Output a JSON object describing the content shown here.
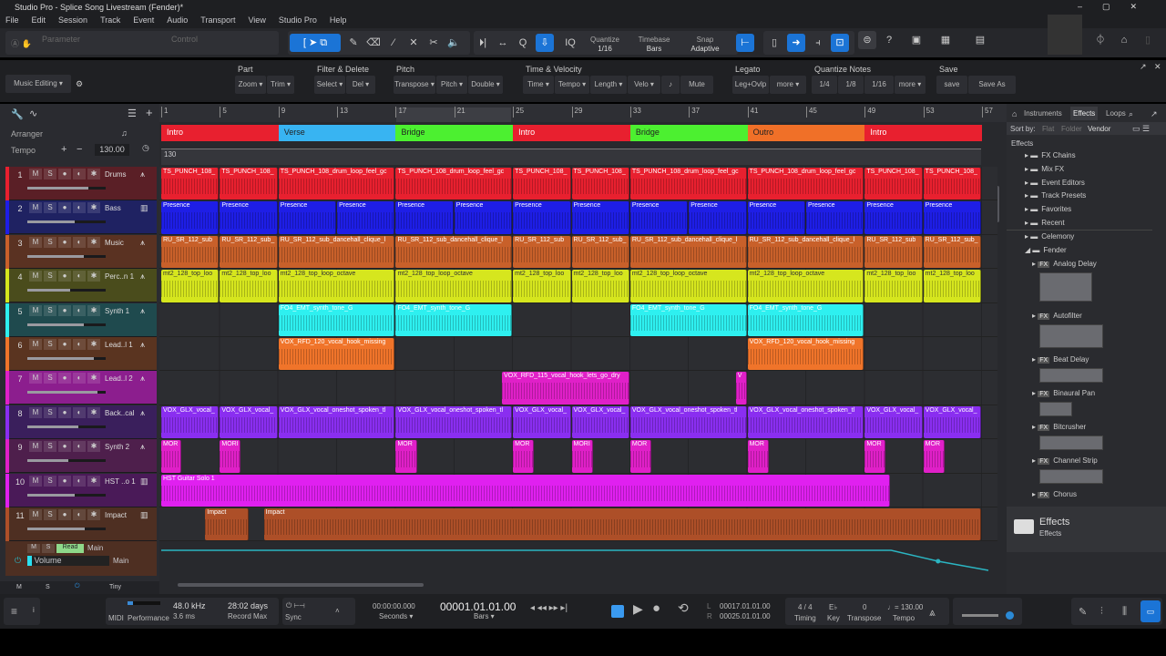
{
  "window_title": "Studio Pro - Splice Song Livestream (Fender)*",
  "menu": [
    "File",
    "Edit",
    "Session",
    "Track",
    "Event",
    "Audio",
    "Transport",
    "View",
    "Studio Pro",
    "Help"
  ],
  "toolbar": {
    "parameter": "Parameter",
    "control": "Control",
    "quantize_label": "Quantize",
    "quantize": "1/16",
    "timebase_label": "Timebase",
    "timebase": "Bars",
    "snap_label": "Snap",
    "snap": "Adaptive",
    "iq": "IQ",
    "help": "?"
  },
  "macro": {
    "preset": "Music Editing",
    "groups": [
      {
        "title": "Part",
        "buttons": [
          "Zoom ▾",
          "Trim ▾"
        ]
      },
      {
        "title": "Filter & Delete",
        "buttons": [
          "Select ▾",
          "Del ▾"
        ]
      },
      {
        "title": "Pitch",
        "buttons": [
          "Transpose ▾",
          "Pitch ▾",
          "Double ▾"
        ]
      },
      {
        "title": "Time & Velocity",
        "buttons": [
          "Time ▾",
          "Tempo ▾",
          "Length ▾",
          "Velo ▾",
          "♪",
          "Mute"
        ]
      },
      {
        "title": "Legato",
        "buttons": [
          "Leg+Ovlp",
          "more ▾"
        ]
      },
      {
        "title": "Quantize Notes",
        "buttons": [
          "1/4",
          "1/8",
          "1/16",
          "more ▾"
        ]
      },
      {
        "title": "Save",
        "buttons": [
          "save",
          "Save As"
        ]
      }
    ]
  },
  "arranger": {
    "label": "Arranger",
    "tempo_label": "Tempo",
    "tempo": "130.00",
    "tempo_lane_value": "130",
    "sections": [
      {
        "name": "Intro",
        "start": 1,
        "end": 9,
        "color": "#e8202f"
      },
      {
        "name": "Verse",
        "start": 9,
        "end": 17,
        "color": "#38b4f2"
      },
      {
        "name": "Bridge",
        "start": 17,
        "end": 25,
        "color": "#4cf030"
      },
      {
        "name": "Intro",
        "start": 25,
        "end": 33,
        "color": "#e8202f"
      },
      {
        "name": "Bridge",
        "start": 33,
        "end": 41,
        "color": "#4cf030"
      },
      {
        "name": "Outro",
        "start": 41,
        "end": 49,
        "color": "#f07028"
      },
      {
        "name": "Intro",
        "start": 49,
        "end": 57,
        "color": "#e8202f"
      }
    ],
    "ruler": [
      "1",
      "5",
      "9",
      "13",
      "17",
      "21",
      "25",
      "29",
      "33",
      "37",
      "41",
      "45",
      "49",
      "53",
      "57"
    ]
  },
  "tracks": [
    {
      "num": "1",
      "name": "Drums",
      "type": "audio",
      "color": "#e8202f",
      "bg": "#5a1f26",
      "fader": 0.78,
      "clips": [
        [
          1,
          5,
          "TS_PUNCH_108_"
        ],
        [
          5,
          9,
          "TS_PUNCH_108_"
        ],
        [
          9,
          17,
          "TS_PUNCH_108_drum_loop_feel_gc"
        ],
        [
          17,
          25,
          "TS_PUNCH_108_drum_loop_feel_gc"
        ],
        [
          25,
          29,
          "TS_PUNCH_108_"
        ],
        [
          29,
          33,
          "TS_PUNCH_108_"
        ],
        [
          33,
          41,
          "TS_PUNCH_108_drum_loop_feel_gc"
        ],
        [
          41,
          49,
          "TS_PUNCH_108_drum_loop_feel_gc"
        ],
        [
          49,
          53,
          "TS_PUNCH_108_"
        ],
        [
          53,
          57,
          "TS_PUNCH_108_"
        ]
      ]
    },
    {
      "num": "2",
      "name": "Bass",
      "type": "instrument",
      "color": "#1e1ee6",
      "bg": "#1f2262",
      "fader": 0.6,
      "clips": [
        [
          1,
          5,
          "Presence"
        ],
        [
          5,
          9,
          "Presence"
        ],
        [
          9,
          13,
          "Presence"
        ],
        [
          13,
          17,
          "Presence"
        ],
        [
          17,
          21,
          "Presence"
        ],
        [
          21,
          25,
          "Presence"
        ],
        [
          25,
          29,
          "Presence"
        ],
        [
          29,
          33,
          "Presence"
        ],
        [
          33,
          37,
          "Presence"
        ],
        [
          37,
          41,
          "Presence"
        ],
        [
          41,
          45,
          "Presence"
        ],
        [
          45,
          49,
          "Presence"
        ],
        [
          49,
          53,
          "Presence"
        ],
        [
          53,
          57,
          "Presence"
        ]
      ]
    },
    {
      "num": "3",
      "name": "Music",
      "type": "audio",
      "color": "#c8602a",
      "bg": "#5a3222",
      "fader": 0.72,
      "clips": [
        [
          1,
          5,
          "RU_SR_112_sub"
        ],
        [
          5,
          9,
          "RU_SR_112_sub_"
        ],
        [
          9,
          17,
          "RU_SR_112_sub_dancehall_clique_l"
        ],
        [
          17,
          25,
          "RU_SR_112_sub_dancehall_clique_l"
        ],
        [
          25,
          29,
          "RU_SR_112_sub"
        ],
        [
          29,
          33,
          "RU_SR_112_sub_"
        ],
        [
          33,
          41,
          "RU_SR_112_sub_dancehall_clique_l"
        ],
        [
          41,
          49,
          "RU_SR_112_sub_dancehall_clique_l"
        ],
        [
          49,
          53,
          "RU_SR_112_sub"
        ],
        [
          53,
          57,
          "RU_SR_112_sub_"
        ]
      ]
    },
    {
      "num": "4",
      "name": "Perc..n 1",
      "type": "audio",
      "color": "#d6e61e",
      "bg": "#4a4c1c",
      "fader": 0.55,
      "clips": [
        [
          1,
          5,
          "mt2_128_top_loo"
        ],
        [
          5,
          9,
          "mt2_128_top_loo"
        ],
        [
          9,
          17,
          "mt2_128_top_loop_octave"
        ],
        [
          17,
          25,
          "mt2_128_top_loop_octave"
        ],
        [
          25,
          29,
          "mt2_128_top_loo"
        ],
        [
          29,
          33,
          "mt2_128_top_loo"
        ],
        [
          33,
          41,
          "mt2_128_top_loop_octave"
        ],
        [
          41,
          49,
          "mt2_128_top_loop_octave"
        ],
        [
          49,
          53,
          "mt2_128_top_loo"
        ],
        [
          53,
          57,
          "mt2_128_top_loo"
        ]
      ]
    },
    {
      "num": "5",
      "name": "Synth 1",
      "type": "audio",
      "color": "#2ef0f0",
      "bg": "#1f4a4e",
      "fader": 0.72,
      "clips": [
        [
          9,
          17,
          "FO4_EMT_synth_tone_G"
        ],
        [
          17,
          25,
          "FO4_EMT_synth_tone_G"
        ],
        [
          33,
          41,
          "FO4_EMT_synth_tone_G"
        ],
        [
          41,
          49,
          "FO4_EMT_synth_tone_G"
        ]
      ]
    },
    {
      "num": "6",
      "name": "Lead..l 1",
      "type": "audio",
      "color": "#f0742a",
      "bg": "#5a3420",
      "fader": 0.85,
      "clips": [
        [
          9,
          17,
          "VOX_RFD_120_vocal_hook_missing"
        ],
        [
          41,
          49,
          "VOX_RFD_120_vocal_hook_missing"
        ]
      ]
    },
    {
      "num": "7",
      "name": "Lead..l 2",
      "type": "audio",
      "color": "#e020c8",
      "bg": "#8c1e8e",
      "fader": 0.9,
      "selected": true,
      "clips": [
        [
          24.25,
          33,
          "VOX_RFD_115_vocal_hook_lets_go_dry"
        ],
        [
          40.2,
          41,
          "V"
        ]
      ]
    },
    {
      "num": "8",
      "name": "Back..cal",
      "type": "audio",
      "color": "#8a2ef0",
      "bg": "#3a1f5c",
      "fader": 0.65,
      "clips": [
        [
          1,
          5,
          "VOX_GLX_vocal_"
        ],
        [
          5,
          9,
          "VOX_GLX_vocal_"
        ],
        [
          9,
          17,
          "VOX_GLX_vocal_oneshot_spoken_tl"
        ],
        [
          17,
          25,
          "VOX_GLX_vocal_oneshot_spoken_tl"
        ],
        [
          25,
          29,
          "VOX_GLX_vocal_"
        ],
        [
          29,
          33,
          "VOX_GLX_vocal_"
        ],
        [
          33,
          41,
          "VOX_GLX_vocal_oneshot_spoken_tl"
        ],
        [
          41,
          49,
          "VOX_GLX_vocal_oneshot_spoken_tl"
        ],
        [
          49,
          53,
          "VOX_GLX_vocal_"
        ],
        [
          53,
          57,
          "VOX_GLX_vocal_"
        ]
      ]
    },
    {
      "num": "9",
      "name": "Synth 2",
      "type": "audio",
      "color": "#e020c8",
      "bg": "#4e1f4c",
      "fader": 0.52,
      "clips": [
        [
          1,
          2.4,
          "MOR"
        ],
        [
          5,
          6.5,
          "MORI"
        ],
        [
          17,
          18.5,
          "MOR"
        ],
        [
          25,
          26.5,
          "MOR"
        ],
        [
          29,
          30.5,
          "MORI"
        ],
        [
          33,
          34.5,
          "MOR"
        ],
        [
          41,
          42.5,
          "MOR"
        ],
        [
          49,
          50.5,
          "MOR"
        ],
        [
          53,
          54.5,
          "MOR"
        ]
      ]
    },
    {
      "num": "10",
      "name": "HST ..o 1",
      "type": "instrument",
      "color": "#e020f0",
      "bg": "#4a1a58",
      "fader": 0.6,
      "clips": [
        [
          1,
          50.8,
          "HST Guitar Solo 1"
        ]
      ]
    },
    {
      "num": "11",
      "name": "Impact",
      "type": "instrument",
      "color": "#ad4f28",
      "bg": "#4e2f22",
      "fader": 0.73,
      "clips": [
        [
          4,
          7,
          "Impact"
        ],
        [
          8,
          57,
          "Impact"
        ]
      ]
    }
  ],
  "automation": {
    "m": "M",
    "s": "S",
    "mode": "Read",
    "target": "Main",
    "param": "Volume",
    "output": "Main"
  },
  "header_footer": {
    "m": "M",
    "s": "S",
    "size": "Tiny"
  },
  "browser": {
    "tabs": [
      "Instruments",
      "Effects",
      "Loops"
    ],
    "active_tab": "Effects",
    "sort_by": "Sort by:",
    "sort_options": [
      "Flat",
      "Folder",
      "Vendor"
    ],
    "breadcrumb": "Effects",
    "items": [
      {
        "label": "FX Chains",
        "level": 1
      },
      {
        "label": "Mix FX",
        "level": 1
      },
      {
        "label": "Event Editors",
        "level": 1
      },
      {
        "label": "Track Presets",
        "level": 1
      },
      {
        "label": "Favorites",
        "level": 1
      },
      {
        "label": "Recent",
        "level": 1
      },
      {
        "label": "Celemony",
        "level": 1
      },
      {
        "label": "Fender",
        "level": 1,
        "open": true
      },
      {
        "label": "Analog Delay",
        "level": 2,
        "fx": true
      },
      {
        "label": "Autofilter",
        "level": 2,
        "fx": true
      },
      {
        "label": "Beat Delay",
        "level": 2,
        "fx": true
      },
      {
        "label": "Binaural Pan",
        "level": 2,
        "fx": true
      },
      {
        "label": "Bitcrusher",
        "level": 2,
        "fx": true
      },
      {
        "label": "Channel Strip",
        "level": 2,
        "fx": true
      },
      {
        "label": "Chorus",
        "level": 2,
        "fx": true
      }
    ],
    "footer_title": "Effects",
    "footer_sub": "Effects"
  },
  "transport": {
    "midi": "MIDI",
    "performance": "Performance",
    "sample_rate": "48.0 kHz",
    "latency": "3.6 ms",
    "record_max": "28:02 days",
    "record_max_label": "Record Max",
    "sync": "Sync",
    "seconds": "00:00:00.000",
    "seconds_label": "Seconds ▾",
    "bars": "00001.01.01.00",
    "bars_label": "Bars ▾",
    "loop_l": "00017.01.01.00",
    "loop_r": "00025.01.01.00",
    "l": "L",
    "r": "R",
    "timing": "4 / 4",
    "timing_label": "Timing",
    "key": "E♭",
    "key_label": "Key",
    "transpose": "0",
    "transpose_label": "Transpose",
    "tempo": "= 130.00",
    "tempo_label": "Tempo"
  },
  "colors": {
    "accent": "#1b74d6",
    "automation": "#2bb5c2"
  }
}
